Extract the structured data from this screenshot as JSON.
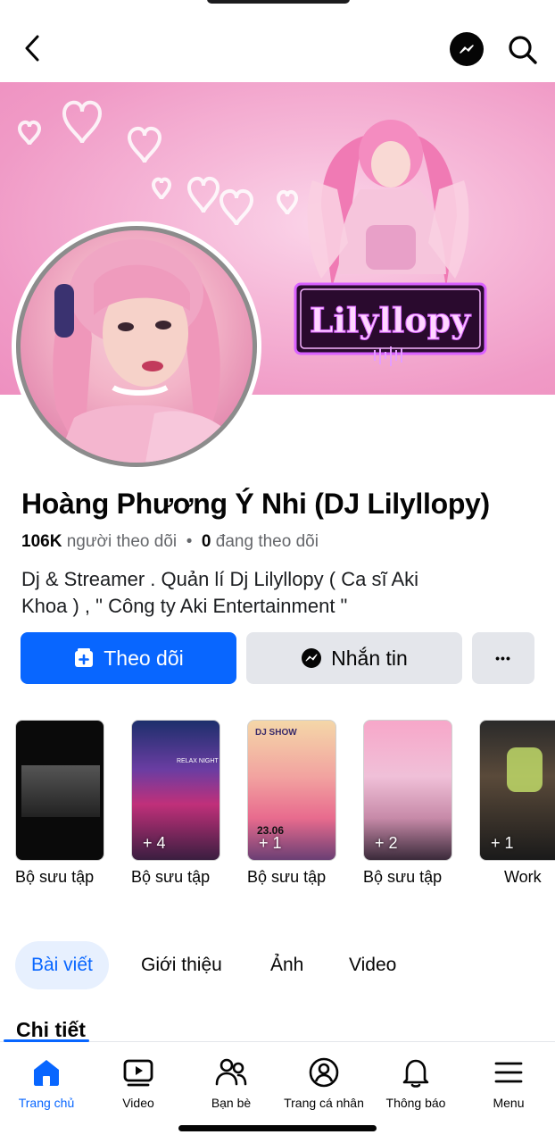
{
  "header": {
    "back_icon": "chevron-left-icon",
    "messenger_icon": "messenger-icon",
    "search_icon": "search-icon"
  },
  "cover": {
    "logo_text": "Lilyllopy"
  },
  "profile": {
    "name": "Hoàng Phương Ý Nhi (DJ Lilyllopy)",
    "followers_count": "106K",
    "followers_label": "người theo dõi",
    "separator": "•",
    "following_count": "0",
    "following_label": "đang theo dõi",
    "bio_line1": "Dj & Streamer . Quản lí Dj Lilyllopy ( Ca sĩ Aki",
    "bio_line2": "Khoa ) , \" Công ty Aki Entertainment \""
  },
  "actions": {
    "follow_label": "Theo dõi",
    "message_label": "Nhắn tin",
    "more_label": "•••"
  },
  "highlights": [
    {
      "label": "Bộ sưu tập",
      "count": ""
    },
    {
      "label": "Bộ sưu tập",
      "count": "+ 4",
      "thumb_text": "RELAX NIGHT"
    },
    {
      "label": "Bộ sưu tập",
      "count": "+ 1",
      "thumb_text": "DJ SHOW",
      "thumb_date": "23.06"
    },
    {
      "label": "Bộ sưu tập",
      "count": "+ 2"
    },
    {
      "label": "Work",
      "count": "+ 1"
    }
  ],
  "tabs": [
    {
      "label": "Bài viết",
      "active": true
    },
    {
      "label": "Giới thiệu",
      "active": false
    },
    {
      "label": "Ảnh",
      "active": false
    },
    {
      "label": "Video",
      "active": false
    }
  ],
  "section_title": "Chi tiết",
  "bottom_nav": [
    {
      "label": "Trang chủ",
      "icon": "home-icon",
      "active": true
    },
    {
      "label": "Video",
      "icon": "video-icon",
      "active": false
    },
    {
      "label": "Bạn bè",
      "icon": "friends-icon",
      "active": false
    },
    {
      "label": "Trang cá nhân",
      "icon": "profile-icon",
      "active": false
    },
    {
      "label": "Thông báo",
      "icon": "bell-icon",
      "active": false
    },
    {
      "label": "Menu",
      "icon": "menu-icon",
      "active": false
    }
  ],
  "colors": {
    "accent": "#0866ff",
    "button_gray": "#e4e6eb",
    "cover_pink": "#f6b8d8"
  }
}
